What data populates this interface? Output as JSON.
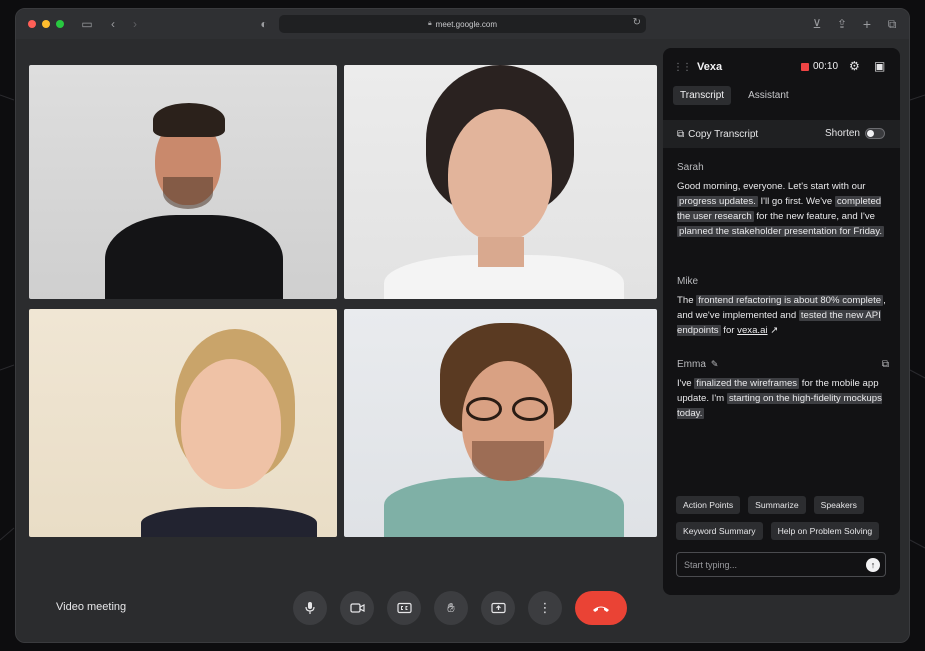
{
  "browser": {
    "url": "meet.google.com"
  },
  "meeting": {
    "title": "Video meeting"
  },
  "panel": {
    "brand": "Vexa",
    "timer": "00:10",
    "tabs": [
      {
        "label": "Transcript",
        "active": true
      },
      {
        "label": "Assistant",
        "active": false
      }
    ],
    "copy_label": "Copy Transcript",
    "shorten_label": "Shorten",
    "transcript": [
      {
        "speaker": "Sarah",
        "parts": [
          {
            "t": "Good morning, everyone. Let's start with our ",
            "hl": false
          },
          {
            "t": "progress updates.",
            "hl": true
          },
          {
            "t": " I'll go first. We've ",
            "hl": false
          },
          {
            "t": "completed the user research",
            "hl": true
          },
          {
            "t": " for the new feature, and I've ",
            "hl": false
          },
          {
            "t": "planned the stakeholder presentation for Friday.",
            "hl": true
          }
        ]
      },
      {
        "speaker": "Mike",
        "parts": [
          {
            "t": "The ",
            "hl": false
          },
          {
            "t": "frontend refactoring is about 80% complete",
            "hl": true
          },
          {
            "t": ", and we've implemented and ",
            "hl": false
          },
          {
            "t": "tested the new API endpoints",
            "hl": true
          },
          {
            "t": " for ",
            "hl": false
          },
          {
            "t": "vexa.ai",
            "hl": false,
            "link": true
          },
          {
            "t": " ↗",
            "hl": false
          }
        ]
      },
      {
        "speaker": "Emma",
        "parts": [
          {
            "t": "I've ",
            "hl": false
          },
          {
            "t": "finalized the wireframes",
            "hl": true
          },
          {
            "t": " for the mobile app update. I'm ",
            "hl": false
          },
          {
            "t": "starting on the high-fidelity mockups today.",
            "hl": true
          }
        ]
      }
    ],
    "chips_row1": [
      "Action Points",
      "Summarize",
      "Speakers"
    ],
    "chips_row2": [
      "Keyword Summary",
      "Help on Problem Solving"
    ],
    "input_placeholder": "Start typing..."
  },
  "colors": {
    "end_call": "#ea4335",
    "record": "#ef4444",
    "panel_bg": "#121214"
  }
}
